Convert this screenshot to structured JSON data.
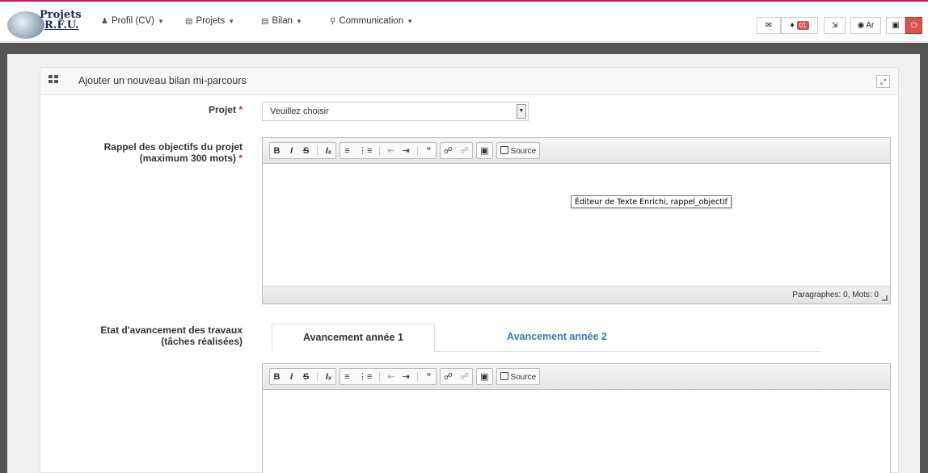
{
  "topbar": {
    "logo_line1": "Projets",
    "logo_line2": "R.F.U.",
    "menu": [
      {
        "icon": "user-icon",
        "label": "Profil (CV)"
      },
      {
        "icon": "briefcase-icon",
        "label": "Projets"
      },
      {
        "icon": "briefcase-icon",
        "label": "Bilan"
      },
      {
        "icon": "comments-icon",
        "label": "Communication"
      }
    ],
    "notification_count": "01",
    "language_label": "Ar",
    "accent_color": "#c2185b"
  },
  "portlet": {
    "title": "Ajouter un nouveau bilan mi-parcours"
  },
  "form": {
    "projet_label": "Projet",
    "required_mark": "*",
    "projet_select_value": "Veuillez choisir",
    "rappel_label_line1": "Rappel des objectifs du projet",
    "rappel_label_line2": "(maximum 300 mots)",
    "etat_label_line1": "Etat d'avancement des travaux",
    "etat_label_line2": "(tâches réalisées)"
  },
  "editor": {
    "source_label": "Source",
    "status": "Paragraphes: 0, Mots: 0",
    "tooltip": "Éditeur de Texte Enrichi, rappel_objectif"
  },
  "tabs": [
    {
      "label": "Avancement année 1",
      "active": true
    },
    {
      "label": "Avancement année 2",
      "active": false
    }
  ]
}
